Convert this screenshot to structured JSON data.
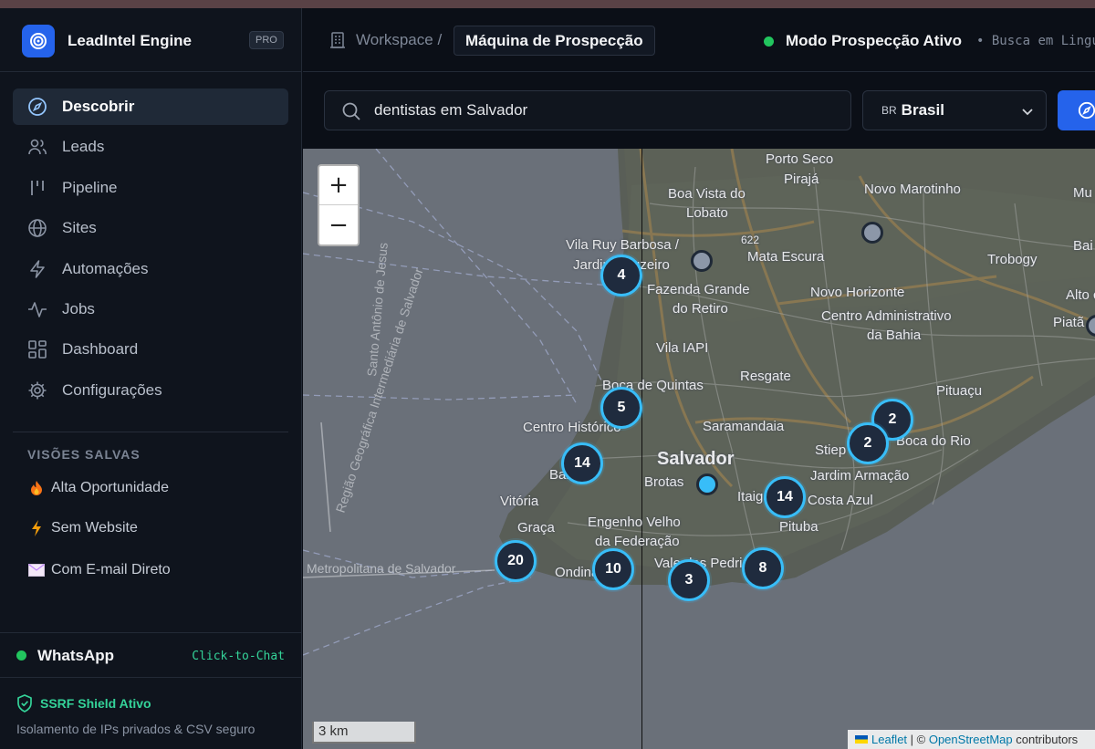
{
  "brand": {
    "name": "LeadIntel Engine",
    "badge": "PRO"
  },
  "nav": [
    {
      "label": "Descobrir",
      "icon": "compass-icon",
      "active": true
    },
    {
      "label": "Leads",
      "icon": "users-icon"
    },
    {
      "label": "Pipeline",
      "icon": "pipeline-icon"
    },
    {
      "label": "Sites",
      "icon": "globe-icon"
    },
    {
      "label": "Automações",
      "icon": "lightning-icon"
    },
    {
      "label": "Jobs",
      "icon": "activity-icon"
    },
    {
      "label": "Dashboard",
      "icon": "dashboard-icon"
    },
    {
      "label": "Configurações",
      "icon": "gear-icon"
    }
  ],
  "saved_views": {
    "title": "VISÕES SALVAS",
    "items": [
      {
        "label": "Alta Oportunidade",
        "icon": "fire-icon"
      },
      {
        "label": "Sem Website",
        "icon": "bolt-icon"
      },
      {
        "label": "Com E-mail Direto",
        "icon": "envelope-icon"
      }
    ]
  },
  "whatsapp": {
    "label": "WhatsApp",
    "cta": "Click-to-Chat"
  },
  "ssrf": {
    "title": "SSRF Shield Ativo",
    "subtitle": "Isolamento de IPs privados & CSV seguro"
  },
  "header": {
    "breadcrumb_root": "Workspace /",
    "breadcrumb_current": "Máquina de Prospecção",
    "status": "Modo Prospecção Ativo",
    "status_sub": "• Busca em Lingu"
  },
  "search": {
    "value": "dentistas em Salvador",
    "country_code": "BR",
    "country": "Brasil"
  },
  "map": {
    "zoom_in": "+",
    "zoom_out": "−",
    "scale": "3 km",
    "attribution": {
      "leaflet": "Leaflet",
      "sep": " | © ",
      "osm": "OpenStreetMap",
      "suffix": " contributors"
    },
    "places": [
      {
        "label": "Porto Seco"
      },
      {
        "label": "Pirajá"
      },
      {
        "label": "Boa Vista do"
      },
      {
        "label": "Lobato"
      },
      {
        "label": "Novo Marotinho"
      },
      {
        "label": "Mu"
      },
      {
        "label": "Vila Ruy Barbosa /"
      },
      {
        "label": "Jardim Cruzeiro"
      },
      {
        "label": "622"
      },
      {
        "label": "Mata Escura"
      },
      {
        "label": "Trobogy"
      },
      {
        "label": "Bai"
      },
      {
        "label": "Fazenda Grande"
      },
      {
        "label": "do Retiro"
      },
      {
        "label": "Novo Horizonte"
      },
      {
        "label": "Alto c"
      },
      {
        "label": "Centro Administrativo"
      },
      {
        "label": "da Bahia"
      },
      {
        "label": "Piatã"
      },
      {
        "label": "Vila IAPI"
      },
      {
        "label": "Resgate"
      },
      {
        "label": "Boca de Quintas"
      },
      {
        "label": "Pituaçu"
      },
      {
        "label": "Centro Histórico"
      },
      {
        "label": "Saramandaia"
      },
      {
        "label": "Salvador"
      },
      {
        "label": "Stiep"
      },
      {
        "label": "Boca do Rio"
      },
      {
        "label": "Brotas"
      },
      {
        "label": "Jardim Armação"
      },
      {
        "label": "Barra"
      },
      {
        "label": "Itaigara"
      },
      {
        "label": "Costa Azul"
      },
      {
        "label": "Vitória"
      },
      {
        "label": "Graça"
      },
      {
        "label": "Engenho Velho"
      },
      {
        "label": "da Federação"
      },
      {
        "label": "Pituba"
      },
      {
        "label": "Ondina"
      },
      {
        "label": "Vale das Pedrinhas"
      },
      {
        "label": "Região Geográfica Intermediária de Salvador"
      },
      {
        "label": "Metropolitana de Salvador"
      },
      {
        "label": "Santo Antônio de Jesus"
      }
    ],
    "clusters": [
      {
        "count": "4"
      },
      {
        "count": "5"
      },
      {
        "count": "14"
      },
      {
        "count": "2"
      },
      {
        "count": "2"
      },
      {
        "count": "14"
      },
      {
        "count": "20"
      },
      {
        "count": "10"
      },
      {
        "count": "3"
      },
      {
        "count": "8"
      }
    ]
  },
  "colors": {
    "accent": "#2563eb",
    "success": "#22c55e",
    "cluster_ring": "#38bdf8",
    "sidebar_bg": "#0f141d"
  }
}
